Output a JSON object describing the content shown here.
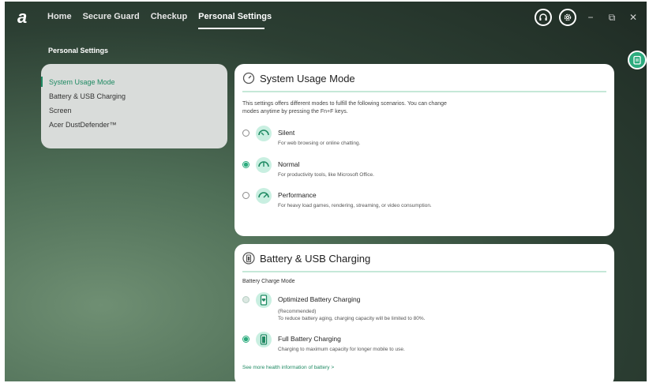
{
  "topbar": {
    "logo": "a",
    "nav": [
      "Home",
      "Secure Guard",
      "Checkup",
      "Personal Settings"
    ],
    "active_nav": "Personal Settings",
    "window_controls": {
      "minimize": "−",
      "restore": "⧉",
      "close": "✕"
    },
    "icons": [
      "headset-icon",
      "gear-icon"
    ]
  },
  "page": {
    "label": "Personal Settings"
  },
  "sidebar": {
    "items": [
      {
        "label": "System Usage Mode",
        "active": true
      },
      {
        "label": "Battery & USB Charging"
      },
      {
        "label": "Screen"
      },
      {
        "label": "Acer DustDefender™"
      }
    ]
  },
  "usage": {
    "title": "System Usage Mode",
    "description": "This settings offers different modes to fulfill the following scenarios. You can change modes anytime by pressing the Fn+F keys.",
    "options": [
      {
        "label": "Silent",
        "sub": "For web browsing or online chatting.",
        "selected": false
      },
      {
        "label": "Normal",
        "sub": "For productivity tools, like Microsoft Office.",
        "selected": true
      },
      {
        "label": "Performance",
        "sub": "For heavy load games, rendering, streaming, or video consumption.",
        "selected": false
      }
    ]
  },
  "battery": {
    "title": "Battery & USB Charging",
    "charge_mode_label": "Battery Charge Mode",
    "options": [
      {
        "label": "Optimized Battery Charging",
        "sub1": "(Recommended)",
        "sub2": "To reduce battery aging, charging capacity will be limited to 80%.",
        "selected": false
      },
      {
        "label": "Full Battery Charging",
        "sub": "Charging to maximum capacity for longer mobile to use.",
        "selected": true
      }
    ],
    "link": "See more health information of battery >"
  },
  "colors": {
    "accent": "#2bab7d",
    "accent_dark": "#1f8a63",
    "icon_bg": "#c9efe1"
  }
}
